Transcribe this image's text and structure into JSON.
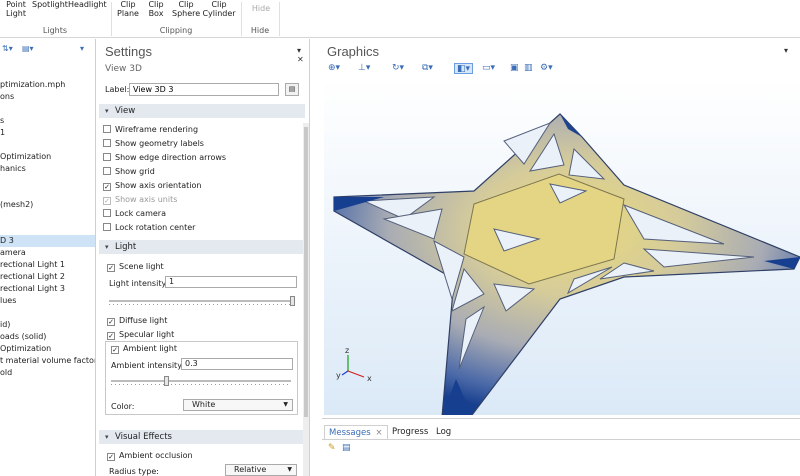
{
  "ribbon": {
    "lights": [
      {
        "line1": "Point",
        "line2": "Light"
      },
      {
        "line1": "Spotlight",
        "line2": ""
      },
      {
        "line1": "Headlight",
        "line2": ""
      }
    ],
    "lights_group": "Lights",
    "clipping": [
      {
        "line1": "Clip",
        "line2": "Plane"
      },
      {
        "line1": "Clip",
        "line2": "Box"
      },
      {
        "line1": "Clip",
        "line2": "Sphere"
      },
      {
        "line1": "Clip",
        "line2": "Cylinder"
      }
    ],
    "clipping_group": "Clipping",
    "hide_label": "Hide",
    "hide_group": "Hide"
  },
  "tree": {
    "toolbar": [
      "▾",
      "⇅▾",
      "▤▾"
    ],
    "items": [
      {
        "text": "ptimization.mph",
        "selected": false
      },
      {
        "text": "ons",
        "selected": false
      },
      {
        "text": "",
        "selected": false
      },
      {
        "text": "s",
        "selected": false
      },
      {
        "text": "1",
        "selected": false
      },
      {
        "text": "",
        "selected": false
      },
      {
        "text": "Optimization",
        "selected": false
      },
      {
        "text": "hanics",
        "selected": false
      },
      {
        "text": "",
        "selected": false
      },
      {
        "text": "",
        "selected": false
      },
      {
        "text": "(mesh2)",
        "selected": false
      },
      {
        "text": "",
        "selected": false
      },
      {
        "text": "",
        "selected": false
      },
      {
        "text": "D 3",
        "selected": true
      },
      {
        "text": "amera",
        "selected": false
      },
      {
        "text": "rectional Light 1",
        "selected": false
      },
      {
        "text": "rectional Light 2",
        "selected": false
      },
      {
        "text": "rectional Light 3",
        "selected": false
      },
      {
        "text": "lues",
        "selected": false
      },
      {
        "text": "",
        "selected": false
      },
      {
        "text": "id)",
        "selected": false
      },
      {
        "text": "oads (solid)",
        "selected": false
      },
      {
        "text": "Optimization",
        "selected": false
      },
      {
        "text": "t material volume factor",
        "selected": false
      },
      {
        "text": "old",
        "selected": false
      }
    ]
  },
  "settings": {
    "title": "Settings",
    "subtitle": "View 3D",
    "label_text": "Label:",
    "label_value": "View 3D 3",
    "view_section": "View",
    "view_options": [
      {
        "text": "Wireframe rendering",
        "checked": false,
        "disabled": false
      },
      {
        "text": "Show geometry labels",
        "checked": false,
        "disabled": false
      },
      {
        "text": "Show edge direction arrows",
        "checked": false,
        "disabled": false
      },
      {
        "text": "Show grid",
        "checked": false,
        "disabled": false
      },
      {
        "text": "Show axis orientation",
        "checked": true,
        "disabled": false
      },
      {
        "text": "Show axis units",
        "checked": true,
        "disabled": true
      },
      {
        "text": "Lock camera",
        "checked": false,
        "disabled": false
      },
      {
        "text": "Lock rotation center",
        "checked": false,
        "disabled": false
      }
    ],
    "light_section": "Light",
    "scene_light": "Scene light",
    "light_intensity_label": "Light intensity:",
    "light_intensity_value": "1",
    "light_intensity_slider": 1.0,
    "diffuse_light": "Diffuse light",
    "specular_light": "Specular light",
    "ambient_light": "Ambient light",
    "ambient_intensity_label": "Ambient intensity:",
    "ambient_intensity_value": "0.3",
    "ambient_intensity_slider": 0.3,
    "color_label": "Color:",
    "color_value": "White",
    "visual_section": "Visual Effects",
    "ambient_occlusion": "Ambient occlusion",
    "radius_type_label": "Radius type:",
    "radius_type_value": "Relative"
  },
  "graphics": {
    "title": "Graphics",
    "axis": {
      "x": "x",
      "y": "y",
      "z": "z"
    }
  },
  "messages": {
    "tabs": [
      "Messages",
      "Progress",
      "Log"
    ],
    "close": "×"
  },
  "colors": {
    "accent": "#3a6db5",
    "selection": "#cfe3f7",
    "section_bg": "#e4e9ef",
    "model_center": "#e9d97a",
    "model_edge": "#173f8f"
  }
}
